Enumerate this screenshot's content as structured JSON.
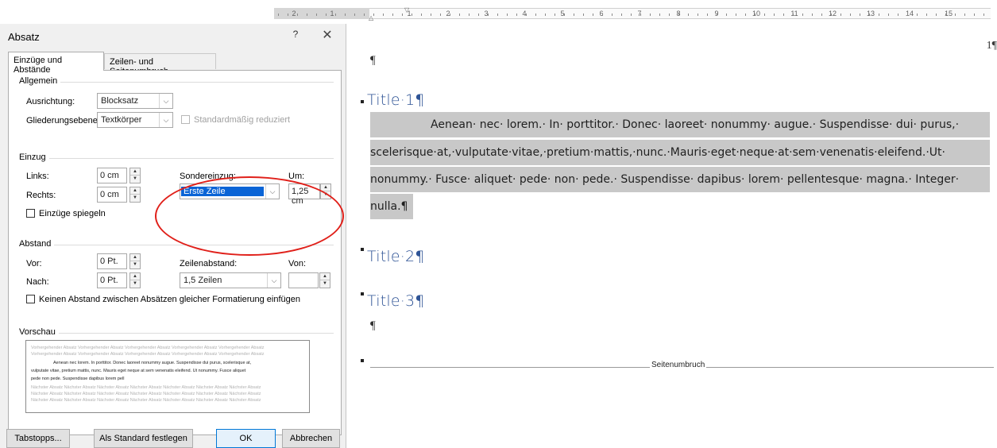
{
  "ruler": {
    "labels": [
      "2",
      "1",
      "1",
      "2",
      "3",
      "4",
      "5",
      "6",
      "7",
      "8",
      "9",
      "10",
      "11",
      "12",
      "13",
      "14",
      "15"
    ]
  },
  "dialog": {
    "title": "Absatz",
    "help": "?",
    "close": "✕",
    "tabs": [
      {
        "label": "Einzüge und Abstände",
        "active": true
      },
      {
        "label": "Zeilen- und Seitenumbruch",
        "active": false
      }
    ],
    "allgemein": {
      "heading": "Allgemein",
      "alignment_label": "Ausrichtung:",
      "alignment_value": "Blocksatz",
      "outline_label": "Gliederungsebene:",
      "outline_value": "Textkörper",
      "collapsed_label": "Standardmäßig reduziert"
    },
    "einzug": {
      "heading": "Einzug",
      "left_label": "Links:",
      "left_value": "0 cm",
      "right_label": "Rechts:",
      "right_value": "0 cm",
      "special_label": "Sondereinzug:",
      "special_value": "Erste Zeile",
      "by_label": "Um:",
      "by_value": "1,25 cm",
      "mirror_label": "Einzüge spiegeln"
    },
    "abstand": {
      "heading": "Abstand",
      "before_label": "Vor:",
      "before_value": "0 Pt.",
      "after_label": "Nach:",
      "after_value": "0 Pt.",
      "line_spacing_label": "Zeilenabstand:",
      "line_spacing_value": "1,5 Zeilen",
      "at_label": "Von:",
      "at_value": "",
      "no_space_label": "Keinen Abstand zwischen Absätzen gleicher Formatierung einfügen"
    },
    "vorschau": {
      "heading": "Vorschau",
      "prev_lines": [
        "Vorhergehender Absatz Vorhergehender Absatz Vorhergehender Absatz Vorhergehender Absatz Vorhergehender Absatz",
        "Vorhergehender Absatz Vorhergehender Absatz Vorhergehender Absatz Vorhergehender Absatz Vorhergehender Absatz"
      ],
      "current_lines": [
        "Aenean nec lorem. In porttitor. Donec laoreet nonummy augue. Suspendisse dui purus, scelerisque at,",
        "vulputate vitae, pretium mattis, nunc. Mauris eget neque at sem venenatis eleifend. Ut nonummy. Fusce aliquet",
        "pede non pede. Suspendisse dapibus lorem pell"
      ],
      "next_lines": [
        "Nächster Absatz Nächster Absatz Nächster Absatz Nächster Absatz Nächster Absatz Nächster Absatz Nächster Absatz",
        "Nächster Absatz Nächster Absatz Nächster Absatz Nächster Absatz Nächster Absatz Nächster Absatz Nächster Absatz",
        "Nächster Absatz Nächster Absatz Nächster Absatz Nächster Absatz Nächster Absatz Nächster Absatz Nächster Absatz"
      ]
    },
    "buttons": {
      "tabs": "Tabstopps...",
      "default": "Als Standard festlegen",
      "ok": "OK",
      "cancel": "Abbrechen"
    }
  },
  "document": {
    "page_number": "1¶",
    "pilcrow": "¶",
    "headings": [
      "Title·1¶",
      "Title·2¶",
      "Title·3¶"
    ],
    "body_lines": [
      "Aenean· nec· lorem.· In· porttitor.· Donec· laoreet· nonummy· augue.· Suspendisse· dui· purus,·",
      "scelerisque·at,·vulputate·vitae,·pretium·mattis,·nunc.·Mauris·eget·neque·at·sem·venenatis·eleifend.·Ut·",
      "nonummy.· Fusce· aliquet· pede· non· pede.· Suspendisse· dapibus· lorem· pellentesque· magna.· Integer·",
      "nulla.¶"
    ],
    "page_break": "Seitenumbruch"
  },
  "colors": {
    "heading_blue": "#2f5496",
    "selection_gray": "#c8c8c8",
    "highlight_red": "#e0201a",
    "dropdown_selected": "#0a64d6"
  }
}
